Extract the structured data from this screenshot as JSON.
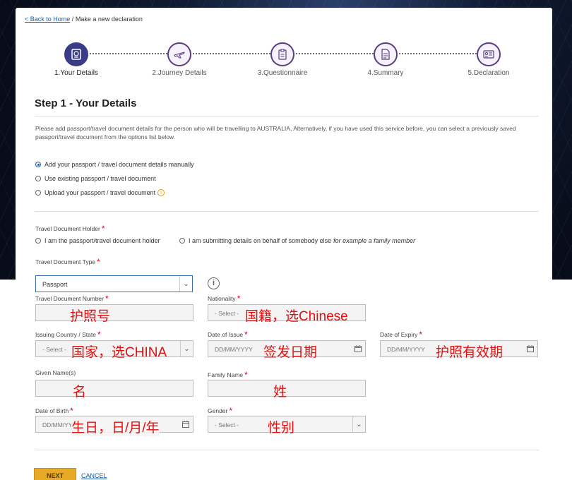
{
  "breadcrumb": {
    "home_link": "< Back to Home",
    "separator": "/",
    "current": "Make a new declaration"
  },
  "stepper": [
    {
      "label": "1.Your Details",
      "icon": "passport-icon",
      "active": true
    },
    {
      "label": "2.Journey Details",
      "icon": "airplane-icon",
      "active": false
    },
    {
      "label": "3.Questionnaire",
      "icon": "clipboard-icon",
      "active": false
    },
    {
      "label": "4.Summary",
      "icon": "document-icon",
      "active": false
    },
    {
      "label": "5.Declaration",
      "icon": "id-card-icon",
      "active": false
    }
  ],
  "page_title": "Step 1 - Your Details",
  "intro": "Please add passport/travel document details for the person who will be travelling to AUSTRALIA. Alternatively, if you have used this service before, you can select a previously saved passport/travel document from the options list below.",
  "source_options": [
    {
      "label": "Add your passport / travel document details manually",
      "checked": true
    },
    {
      "label": "Use existing passport / travel document",
      "checked": false
    },
    {
      "label": "Upload your passport / travel document",
      "checked": false
    }
  ],
  "holder": {
    "label": "Travel Document Holder",
    "required_mark": "*",
    "option_self": "I am the passport/travel document holder",
    "option_other": "I am submitting details on behalf of somebody else",
    "option_other_hint": "for example a family member"
  },
  "doc_type": {
    "label": "Travel Document Type",
    "value": "Passport"
  },
  "fields": {
    "doc_number": {
      "label": "Travel Document Number",
      "value": "",
      "note": "护照号"
    },
    "nationality": {
      "label": "Nationality",
      "value": "- Select -",
      "note": "国籍，选Chinese"
    },
    "issuing_country": {
      "label": "Issuing Country / State",
      "value": "- Select -",
      "note": "国家，选CHINA"
    },
    "date_of_issue": {
      "label": "Date of Issue",
      "placeholder": "DD/MM/YYYY",
      "note": "签发日期"
    },
    "date_of_expiry": {
      "label": "Date of Expiry",
      "placeholder": "DD/MM/YYYY",
      "note": "护照有效期"
    },
    "given_names": {
      "label": "Given Name(s)",
      "value": "",
      "note": "名"
    },
    "family_name": {
      "label": "Family Name",
      "value": "",
      "note": "姓"
    },
    "date_of_birth": {
      "label": "Date of Birth",
      "placeholder": "DD/MM/YYYY",
      "note": "生日，日/月/年"
    },
    "gender": {
      "label": "Gender",
      "value": "- Select -",
      "note": "性别"
    }
  },
  "actions": {
    "next": "NEXT",
    "cancel": "CANCEL"
  },
  "colors": {
    "accent": "#1a5aa8",
    "button": "#e8a924",
    "required": "#d0021b",
    "annotation": "#e21010",
    "step_active": "#3a3d86"
  }
}
